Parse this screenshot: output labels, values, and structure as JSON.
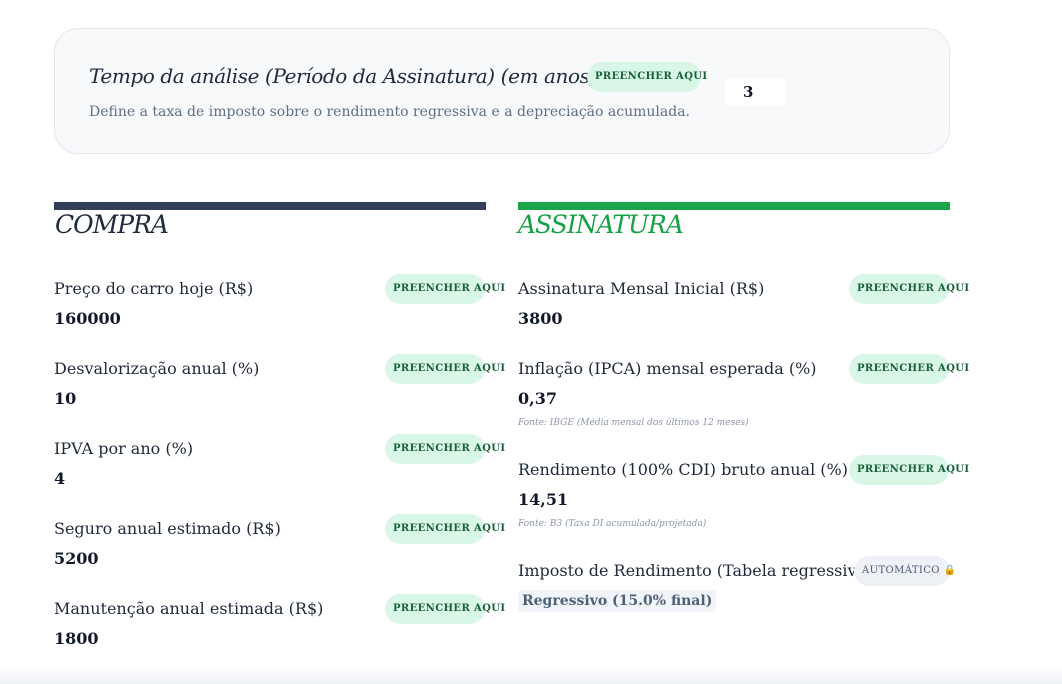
{
  "analysis": {
    "title": "Tempo da análise (Período da Assinatura) (em anos)",
    "description": "Define a taxa de imposto sobre o rendimento regressiva e a depreciação acumulada.",
    "fill_label": "PREENCHER AQUI",
    "value": "3"
  },
  "compra": {
    "title": "COMPRA",
    "fields": [
      {
        "label": "Preço do carro hoje (R$)",
        "value": "160000",
        "action": "PREENCHER AQUI"
      },
      {
        "label": "Desvalorização anual (%)",
        "value": "10",
        "action": "PREENCHER AQUI"
      },
      {
        "label": "IPVA por ano (%)",
        "value": "4",
        "action": "PREENCHER AQUI"
      },
      {
        "label": "Seguro anual estimado (R$)",
        "value": "5200",
        "action": "PREENCHER AQUI"
      },
      {
        "label": "Manutenção anual estimada (R$)",
        "value": "1800",
        "action": "PREENCHER AQUI"
      }
    ]
  },
  "assinatura": {
    "title": "ASSINATURA",
    "fields": [
      {
        "label": "Assinatura Mensal Inicial (R$)",
        "value": "3800",
        "action": "PREENCHER AQUI"
      },
      {
        "label": "Inflação (IPCA) mensal esperada (%)",
        "value": "0,37",
        "action": "PREENCHER AQUI",
        "source": "Fonte: IBGE (Média mensal dos últimos 12 meses)"
      },
      {
        "label": "Rendimento (100% CDI) bruto anual (%)",
        "value": "14,51",
        "action": "PREENCHER AQUI",
        "source": "Fonte: B3 (Taxa DI acumulada/projetada)"
      },
      {
        "label": "Imposto de Rendimento (Tabela regressiva)",
        "value": "Regressivo (15.0% final)",
        "action": "AUTOMÁTICO 🔒"
      }
    ]
  },
  "colors": {
    "compra_accent": "#34405a",
    "assinatura_accent": "#1aa54b",
    "fill_pill_bg": "#d9f7e6",
    "fill_pill_text": "#17603a"
  }
}
